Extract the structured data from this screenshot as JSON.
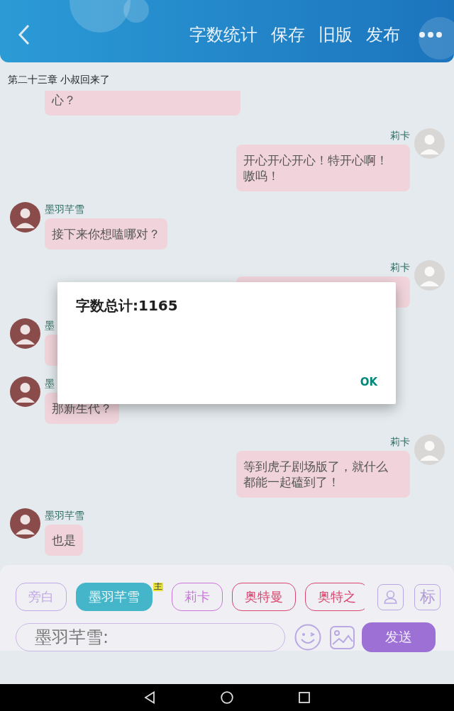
{
  "header": {
    "actions": [
      "字数统计",
      "保存",
      "旧版",
      "发布"
    ]
  },
  "chapter_title": "第二十三章 小叔回来了",
  "messages": [
    {
      "kind": "continuation",
      "outgoing": false,
      "text": "心？"
    },
    {
      "kind": "message",
      "outgoing": true,
      "name": "莉卡",
      "text": "开心开心开心！特开心啊！嗷呜！"
    },
    {
      "kind": "message",
      "outgoing": false,
      "name": "墨羽芊雪",
      "text": "接下来你想嗑哪对？"
    },
    {
      "kind": "message",
      "outgoing": true,
      "name": "莉卡"
    },
    {
      "kind": "message",
      "outgoing": false,
      "name": "墨"
    },
    {
      "kind": "message",
      "outgoing": false,
      "name": "墨",
      "text": "那新生代？"
    },
    {
      "kind": "message",
      "outgoing": true,
      "name": "莉卡",
      "text": "等到虎子剧场版了，就什么都能一起磕到了！"
    },
    {
      "kind": "message",
      "outgoing": false,
      "name": "墨羽芊雪",
      "text": "也是"
    }
  ],
  "dialog": {
    "message": "字数总计:1165",
    "button": "OK"
  },
  "composer": {
    "chips": [
      {
        "label": "旁白",
        "selected": false,
        "color": "#c0a8e4"
      },
      {
        "label": "墨羽芊雪",
        "selected": true,
        "color": "#45b5c9",
        "badge": "主"
      },
      {
        "label": "莉卡",
        "selected": false,
        "color": "#cc72dc"
      },
      {
        "label": "奥特曼",
        "selected": false,
        "color": "#d8456e"
      },
      {
        "label": "奥特之",
        "selected": false,
        "color": "#d8456e"
      }
    ],
    "tag_button": "标",
    "input_value": "墨羽芊雪:",
    "send_button": "发送"
  }
}
